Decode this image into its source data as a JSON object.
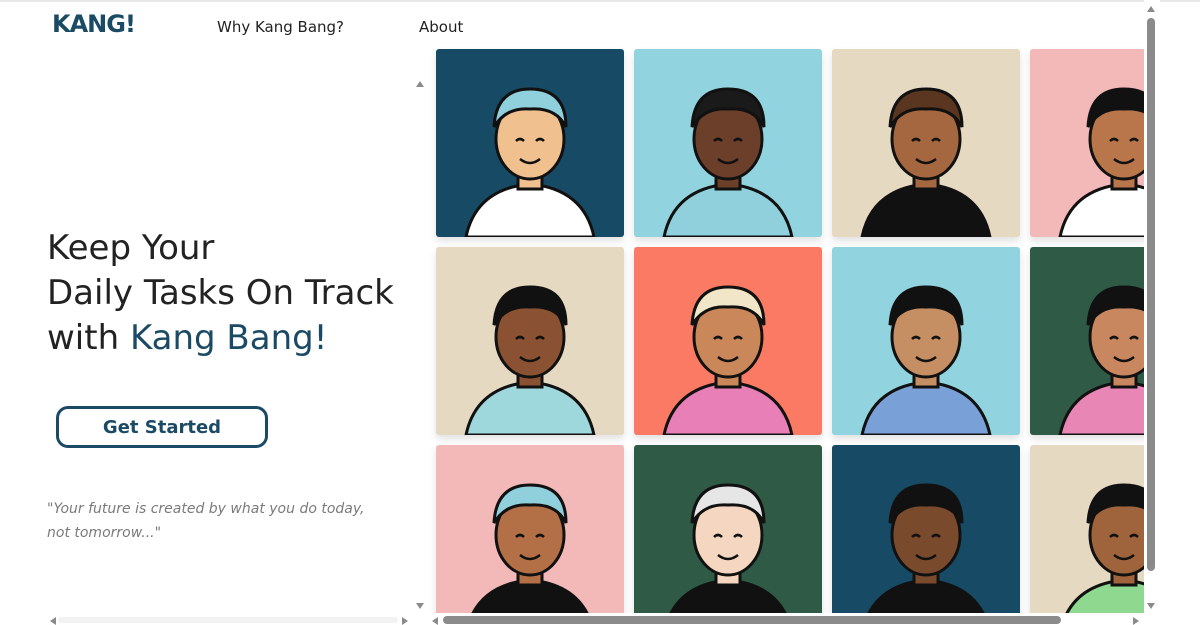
{
  "header": {
    "logo_text": "KANG!",
    "nav": [
      {
        "label": "Why Kang Bang?"
      },
      {
        "label": "About"
      }
    ]
  },
  "hero": {
    "headline_line1": "Keep Your",
    "headline_line2": "Daily Tasks On Track",
    "headline_prefix": "with ",
    "headline_brand": "Kang Bang!",
    "cta_label": "Get Started",
    "quote": "\"Your future is created by what you do today, not tomorrow...\""
  },
  "avatars": [
    {
      "name": "avatar-beanie-polka",
      "bg": "#174a64"
    },
    {
      "name": "avatar-pink-mohawk",
      "bg": "#91d3de"
    },
    {
      "name": "avatar-braid-mustache",
      "bg": "#e6d9c2"
    },
    {
      "name": "avatar-hat-beard",
      "bg": "#f3b8b8"
    },
    {
      "name": "avatar-curly-stripes",
      "bg": "#e6d9c2"
    },
    {
      "name": "avatar-heart-eyes",
      "bg": "#fb7a64"
    },
    {
      "name": "avatar-hijab",
      "bg": "#91d3de"
    },
    {
      "name": "avatar-long-hair",
      "bg": "#2e5a46"
    },
    {
      "name": "avatar-beanie-blush",
      "bg": "#f3b8b8"
    },
    {
      "name": "avatar-gray-bun",
      "bg": "#2e5a46"
    },
    {
      "name": "avatar-puff-bun",
      "bg": "#174a64"
    },
    {
      "name": "avatar-afro-mustache",
      "bg": "#e6d9c2"
    }
  ],
  "colors": {
    "brand": "#1b4a64",
    "text": "#222222",
    "quote": "#7a7a7a"
  }
}
